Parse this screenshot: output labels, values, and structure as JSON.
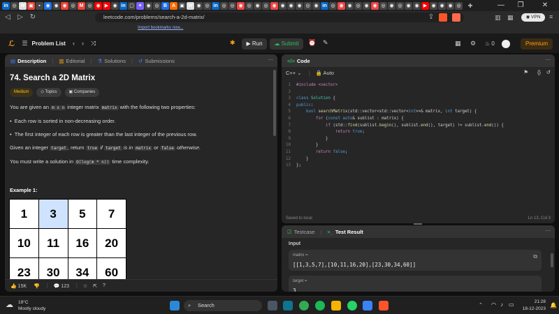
{
  "browser": {
    "tab_glyphs": [
      "in",
      "◎",
      "W",
      "▣",
      "▪",
      "◉",
      "◉",
      "◉",
      "◎",
      "M",
      "◎",
      "◉",
      "▶",
      "◉",
      "in",
      "▢",
      "✦",
      "◉",
      "◎",
      "B",
      "A",
      "▣",
      "W",
      "◉",
      "◎",
      "in",
      "◎",
      "◎",
      "◉",
      "◎",
      "◉",
      "◎",
      "◉",
      "◉",
      "◉",
      "◉",
      "◎",
      "◉",
      "in",
      "◎",
      "◉",
      "◉",
      "◎",
      "◉",
      "◉",
      "◎",
      "◉",
      "◎",
      "◉",
      "◉",
      "▶",
      "◉",
      "◉",
      "◉",
      "◎"
    ],
    "tab_colors": [
      "#0a66c2",
      "#444",
      "#ddd",
      "#ea4335",
      "#444",
      "#1a73e8",
      "#444",
      "#ea4335",
      "#444",
      "#ea4335",
      "#444",
      "#ff0000",
      "#ff0000",
      "#444",
      "#0a66c2",
      "#444",
      "#7b61ff",
      "#444",
      "#444",
      "#1f6feb",
      "#ff6b00",
      "#444",
      "#ddd",
      "#444",
      "#444",
      "#0a66c2",
      "#444",
      "#444",
      "#e44",
      "#444",
      "#444",
      "#444",
      "#e44",
      "#444",
      "#444",
      "#444",
      "#444",
      "#444",
      "#0a66c2",
      "#444",
      "#e44",
      "#444",
      "#444",
      "#444",
      "#e44",
      "#444",
      "#444",
      "#444",
      "#444",
      "#444",
      "#ff0000",
      "#444",
      "#444",
      "#444",
      "#444"
    ],
    "new_tab": "+",
    "url": "leetcode.com/problems/search-a-2d-matrix/",
    "bookmark_text": "Import bookmarks now...",
    "vpn_label": "VPN",
    "ctrl_minimize": "—",
    "ctrl_restore": "❐",
    "ctrl_close": "✕"
  },
  "header": {
    "problem_list": "Problem List",
    "run": "Run",
    "submit": "Submit",
    "streak": "0",
    "premium": "Premium"
  },
  "left_tabs": [
    {
      "label": "Description",
      "icon": "description-icon"
    },
    {
      "label": "Editorial",
      "icon": "editorial-icon"
    },
    {
      "label": "Solutions",
      "icon": "solutions-icon"
    },
    {
      "label": "Submissions",
      "icon": "submissions-icon"
    }
  ],
  "problem": {
    "title": "74. Search a 2D Matrix",
    "difficulty": "Medium",
    "topics": "Topics",
    "companies": "Companies",
    "intro_1": "You are given an",
    "intro_code1": "m x n",
    "intro_2": "integer matrix",
    "intro_code2": "matrix",
    "intro_3": "with the following two properties:",
    "bullet_1": "Each row is sorted in non-decreasing order.",
    "bullet_2": "The first integer of each row is greater than the last integer of the previous row.",
    "given_1": "Given an integer",
    "given_code1": "target",
    "given_2": ", return",
    "given_code2": "true",
    "given_3": "if",
    "given_code3": "target",
    "given_4": "is in",
    "given_code4": "matrix",
    "given_5": "or",
    "given_code5": "false",
    "given_6": "otherwise.",
    "must_1": "You must write a solution in",
    "must_code": "O(log(m * n))",
    "must_2": "time complexity.",
    "example_title": "Example 1:",
    "matrix": [
      [
        "1",
        "3",
        "5",
        "7"
      ],
      [
        "10",
        "11",
        "16",
        "20"
      ],
      [
        "23",
        "30",
        "34",
        "60"
      ]
    ]
  },
  "left_footer": {
    "likes": "15K",
    "comments": "123"
  },
  "code_panel": {
    "title": "Code",
    "language": "C++",
    "mode": "Auto",
    "line_numbers": [
      "1",
      "2",
      "3",
      "4",
      "5",
      "6",
      "7",
      "8",
      "9",
      "10",
      "11",
      "12",
      "13"
    ],
    "saved": "Saved to local",
    "cursor": "Ln 13, Col 3"
  },
  "result_panel": {
    "testcase_tab": "Testcase",
    "result_tab": "Test Result",
    "input_label": "Input",
    "matrix_label": "matrix =",
    "matrix_value": "[[1,3,5,7],[10,11,16,20],[23,30,34,60]]",
    "target_label": "target =",
    "target_value": "3"
  },
  "taskbar": {
    "temp": "19°C",
    "weather": "Mostly cloudy",
    "search": "Search",
    "time": "21:28",
    "date": "18-12-2023"
  }
}
